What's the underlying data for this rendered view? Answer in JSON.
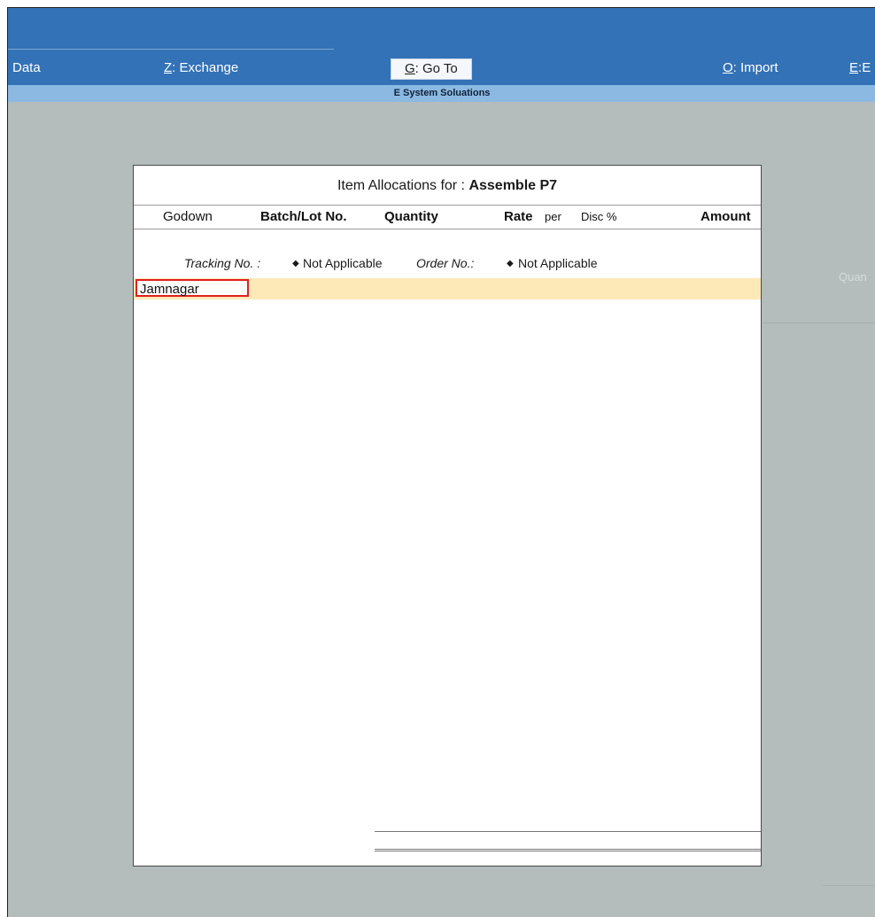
{
  "menu": {
    "data": {
      "label": "Data"
    },
    "exchange": {
      "key": "Z",
      "label": "Exchange"
    },
    "goto": {
      "key": "G",
      "label": "Go To"
    },
    "import": {
      "key": "O",
      "label": "Import"
    },
    "export": {
      "key": "E",
      "label": "E"
    }
  },
  "company": {
    "name": "E System Soluations"
  },
  "background": {
    "quantity_hint": "Quan"
  },
  "dialog": {
    "title_label": "Item Allocations for :",
    "item_name": "Assemble P7",
    "columns": {
      "godown": "Godown",
      "batch": "Batch/Lot No.",
      "quantity": "Quantity",
      "rate": "Rate",
      "per": "per",
      "disc": "Disc %",
      "amount": "Amount"
    },
    "tracking": {
      "tracking_label": "Tracking No. :",
      "tracking_value": "Not Applicable",
      "order_label": "Order No.:",
      "order_value": "Not Applicable"
    },
    "godown_input": {
      "value": "Jamnagar"
    }
  }
}
